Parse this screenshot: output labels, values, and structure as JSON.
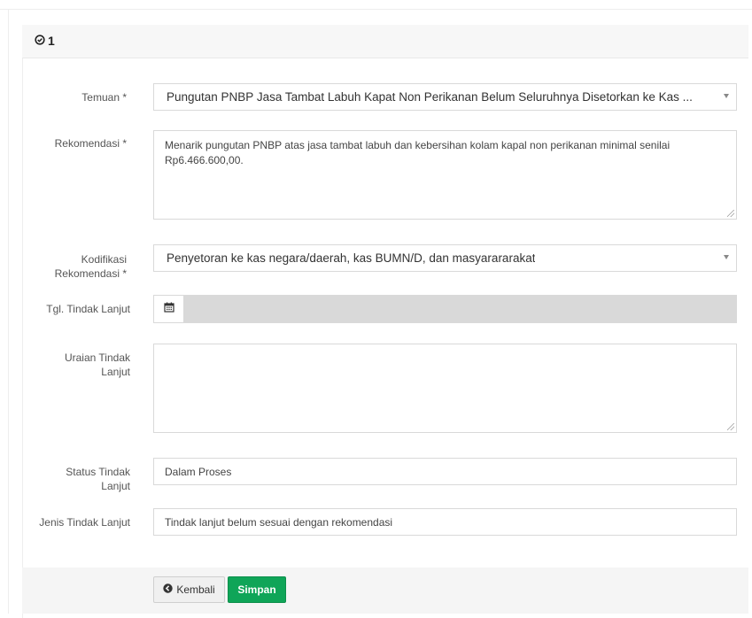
{
  "panel": {
    "title": "1",
    "icon": "check-circle-icon"
  },
  "form": {
    "temuan": {
      "label": "Temuan *",
      "value": "Pungutan PNBP Jasa Tambat Labuh Kapat Non Perikanan Belum Seluruhnya Disetorkan ke Kas ..."
    },
    "rekomendasi": {
      "label": "Rekomendasi *",
      "value": "Menarik pungutan PNBP atas jasa tambat labuh dan kebersihan kolam kapal non perikanan minimal senilai Rp6.466.600,00."
    },
    "kodifikasi": {
      "label_line1": "Kodifikasi",
      "label_line2": "Rekomendasi *",
      "value": "Penyetoran ke kas negara/daerah, kas BUMN/D, dan masyarararakat"
    },
    "tgl": {
      "label": "Tgl. Tindak Lanjut",
      "icon": "calendar-icon",
      "value": ""
    },
    "uraian": {
      "label_line1": "Uraian Tindak",
      "label_line2": "Lanjut",
      "value": ""
    },
    "status": {
      "label_line1": "Status Tindak",
      "label_line2": "Lanjut",
      "value": "Dalam Proses"
    },
    "jenis": {
      "label": "Jenis Tindak Lanjut",
      "value": "Tindak lanjut belum sesuai dengan rekomendasi"
    }
  },
  "buttons": {
    "back_label": "Kembali",
    "back_icon": "arrow-left-circle-icon",
    "save_label": "Simpan"
  },
  "colors": {
    "save_button": "#0fa558",
    "disabled_field": "#d9d9d9",
    "panel_header": "#f7f7f7"
  }
}
